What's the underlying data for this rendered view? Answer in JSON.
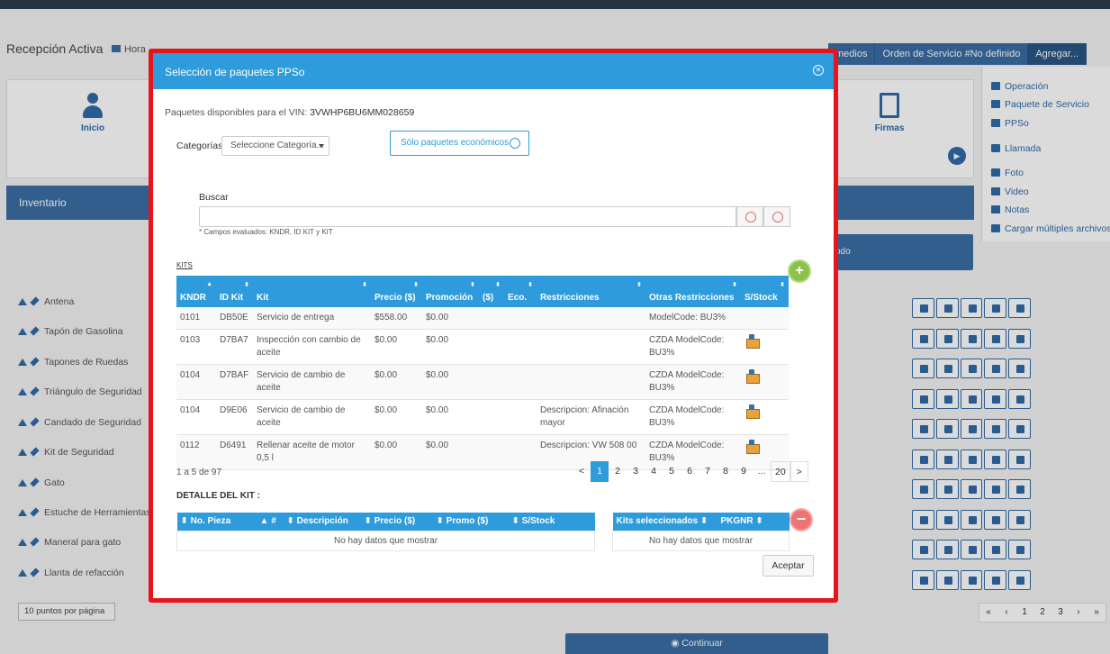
{
  "background": {
    "page_title": "Recepción Activa",
    "hora_label": "Hora",
    "header_buttons": [
      "medios",
      "Orden de Servicio #No definido",
      "Agregar..."
    ],
    "dropdown_items": [
      "Operación",
      "Paquete de Servicio",
      "PPSo",
      "Llamada",
      "Foto",
      "Video",
      "Notas",
      "Cargar múltiples archivos"
    ],
    "nav": {
      "inicio": "Inicio",
      "firmas": "Firmas"
    },
    "inventario_title": "Inventario",
    "todo_label": "odo",
    "inventory_items": [
      "Antena",
      "Tapón de Gasolina",
      "Tapones de Ruedas",
      "Triángulo de Seguridad",
      "Candado de Seguridad",
      "Kit de Seguridad",
      "Gato",
      "Estuche de Herramientas",
      "Maneral para gato",
      "Llanta de refacción"
    ],
    "per_page": "10 puntos por página",
    "pager": [
      "«",
      "‹",
      "1",
      "2",
      "3",
      "›",
      "»"
    ],
    "continuar": "Continuar"
  },
  "modal": {
    "title": "Selección de paquetes PPSo",
    "vin_label": "Paquetes disponibles para el VIN:",
    "vin_value": "3VWHP6BU6MM028659",
    "categorias_label": "Categorías",
    "categorias_placeholder": "Seleccione Categoría...",
    "economicos_label": "Sólo paquetes económicos",
    "buscar_label": "Buscar",
    "buscar_hint": "* Campos evaluados: KNDR, ID KIT y KIT",
    "kits_label": "KITS",
    "kits_headers": [
      "KNDR",
      "ID Kit",
      "Kit",
      "Precio ($)",
      "Promoción",
      "($)",
      "Eco.",
      "Restricciones",
      "Otras Restricciones",
      "S/Stock"
    ],
    "kits_rows": [
      {
        "kndr": "0101",
        "id": "DB50E",
        "kit": "Servicio de entrega",
        "precio": "$558.00",
        "promo": "$0.00",
        "restr": "",
        "otras": "ModelCode: BU3%",
        "stock": false
      },
      {
        "kndr": "0103",
        "id": "D7BA7",
        "kit": "Inspección con cambio de aceite",
        "precio": "$0.00",
        "promo": "$0.00",
        "restr": "",
        "otras": "CZDA ModelCode: BU3%",
        "stock": true
      },
      {
        "kndr": "0104",
        "id": "D7BAF",
        "kit": "Servicio de cambio de aceite",
        "precio": "$0.00",
        "promo": "$0.00",
        "restr": "",
        "otras": "CZDA ModelCode: BU3%",
        "stock": true
      },
      {
        "kndr": "0104",
        "id": "D9E06",
        "kit": "Servicio de cambio de aceite",
        "precio": "$0.00",
        "promo": "$0.00",
        "restr": "Descripcion: Afinación mayor",
        "otras": "CZDA ModelCode: BU3%",
        "stock": true
      },
      {
        "kndr": "0112",
        "id": "D6491",
        "kit": "Rellenar aceite de motor 0,5 l",
        "precio": "$0.00",
        "promo": "$0.00",
        "restr": "Descripcion: VW 508 00",
        "otras": "CZDA ModelCode: BU3%",
        "stock": true
      }
    ],
    "range_text": "1 a 5 de 97",
    "pager": [
      "<",
      "1",
      "2",
      "3",
      "4",
      "5",
      "6",
      "7",
      "8",
      "9",
      "...",
      "20",
      ">"
    ],
    "detalle_label": "DETALLE DEL KIT :",
    "detalle_headers": [
      "No. Pieza",
      "#",
      "Descripción",
      "Precio ($)",
      "Promo ($)",
      "S/Stock"
    ],
    "selected_headers": [
      "Kits seleccionados",
      "PKGNR"
    ],
    "no_data": "No hay datos que mostrar",
    "aceptar": "Aceptar"
  }
}
